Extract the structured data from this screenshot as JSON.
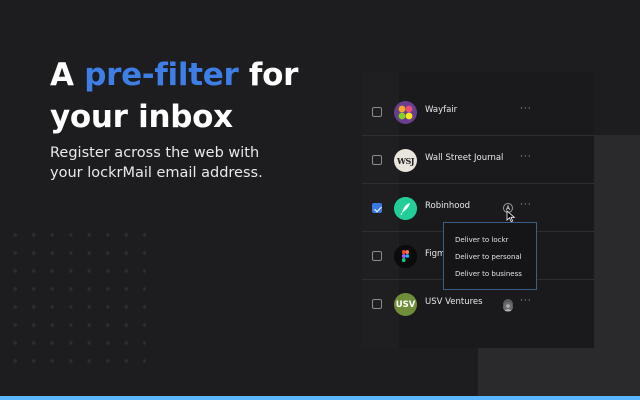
{
  "hero": {
    "title_pre": "A ",
    "title_accent": "pre-filter",
    "title_post": " for",
    "title_line2": "your inbox",
    "subtitle_line1": "Register across the web with",
    "subtitle_line2": "your lockrMail email address."
  },
  "senders": [
    {
      "name": "Wayfair",
      "checked": false,
      "more": "···"
    },
    {
      "name": "Wall Street Journal",
      "checked": false,
      "more": "···",
      "logo_text": "WSJ"
    },
    {
      "name": "Robinhood",
      "checked": true,
      "more": "···"
    },
    {
      "name": "Figma",
      "visible_name": "Figm",
      "checked": false,
      "more": "···"
    },
    {
      "name": "USV Ventures",
      "checked": false,
      "more": "···",
      "logo_text": "USV"
    }
  ],
  "menu": {
    "items": [
      "Deliver to lockr",
      "Deliver to personal",
      "Deliver to business"
    ]
  },
  "colors": {
    "accent": "#3d7fe6",
    "background": "#1d1d1f",
    "bottom_bar": "#5bb5ff",
    "checkbox_checked": "#3b7ae4"
  }
}
